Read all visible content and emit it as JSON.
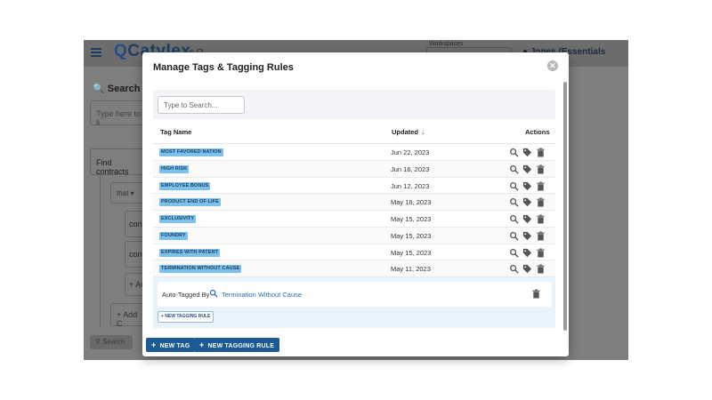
{
  "background": {
    "app_name_prefix": "Q",
    "app_name": "Catylex",
    "topbar_mid": "≡ Q ...",
    "workspace_label": "Workspaces",
    "workspace_chevron": "⌄",
    "user_label": "● Jones (Essentials Alpha) ▾",
    "search_title": "🔍 Search",
    "search_placeholder": "Type here to li",
    "find_contracts": "Find contracts",
    "that_label": "that ▾",
    "cond1": "con",
    "cond2": "con",
    "add1": "+ Ad",
    "add2": "+ Add C",
    "search_button": "⚲ Search"
  },
  "modal": {
    "title": "Manage Tags & Tagging Rules",
    "close_icon": "close-icon",
    "search_placeholder": "Type to Search...",
    "columns": {
      "name": "Tag Name",
      "updated": "Updated",
      "sort_indicator": "↓",
      "actions": "Actions"
    },
    "rows": [
      {
        "tag": "MOST FAVORED NATION",
        "updated": "Jun 22, 2023"
      },
      {
        "tag": "HIGH RISK",
        "updated": "Jun 16, 2023"
      },
      {
        "tag": "EMPLOYEE BONUS",
        "updated": "Jun 12, 2023"
      },
      {
        "tag": "PRODUCT END OF LIFE",
        "updated": "May 16, 2023"
      },
      {
        "tag": "EXCLUSIVITY",
        "updated": "May 15, 2023"
      },
      {
        "tag": "FOUNDRY",
        "updated": "May 15, 2023"
      },
      {
        "tag": "EXPIRES WITH PATENT",
        "updated": "May 15, 2023"
      },
      {
        "tag": "TERMINATION WITHOUT CAUSE",
        "updated": "May 11, 2023"
      }
    ],
    "auto_tagged": {
      "label": "Auto-Tagged By",
      "rule": "Termination Without Cause"
    },
    "new_rule_small": "+ NEW TAGGING RULE",
    "footer": {
      "new_tag": "NEW TAG",
      "new_rule": "NEW TAGGING RULE"
    }
  },
  "colors": {
    "primary": "#1c5a96",
    "tag_bg": "#7cc1ea",
    "tag_text": "#1a3e66",
    "overlay": "#7e7e7e"
  },
  "icons": [
    "menu-icon",
    "search-icon",
    "tag-icon",
    "trash-icon",
    "close-icon",
    "plus-icon"
  ]
}
